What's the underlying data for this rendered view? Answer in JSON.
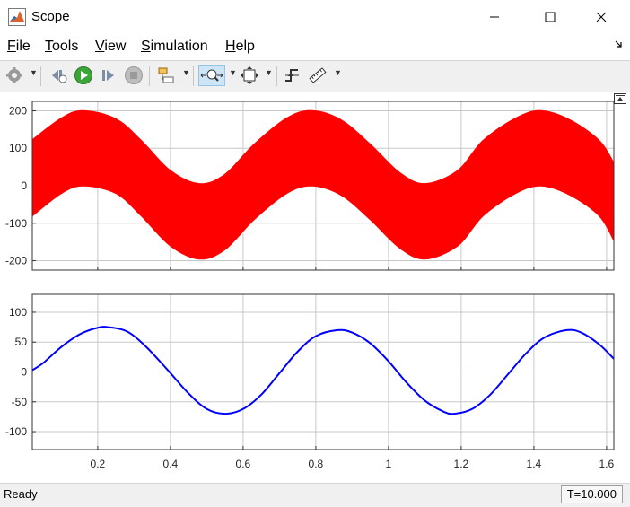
{
  "window": {
    "title": "Scope",
    "controls": [
      "minimize",
      "maximize",
      "close"
    ]
  },
  "menu": {
    "items": [
      {
        "label": "File",
        "mnemonic": "F",
        "rest": "ile"
      },
      {
        "label": "Tools",
        "mnemonic": "T",
        "rest": "ools"
      },
      {
        "label": "View",
        "mnemonic": "V",
        "rest": "iew"
      },
      {
        "label": "Simulation",
        "mnemonic": "S",
        "rest": "imulation"
      },
      {
        "label": "Help",
        "mnemonic": "H",
        "rest": "elp"
      }
    ]
  },
  "toolbar": {
    "buttons": [
      "settings-icon",
      "step-back-icon",
      "run-icon",
      "step-forward-icon",
      "stop-icon",
      "highlight-block-icon",
      "zoom-icon",
      "autoscale-icon",
      "triggers-icon",
      "measurements-icon"
    ],
    "active": "zoom-icon"
  },
  "status": {
    "text": "Ready",
    "time": "T=10.000"
  },
  "colors": {
    "top_signal": "#ff0000",
    "bottom_signal": "#0000ff",
    "grid": "#c8c8c8"
  },
  "chart_data": [
    {
      "type": "line",
      "title": "",
      "xlabel": "",
      "ylabel": "",
      "xlim": [
        0.02,
        1.62
      ],
      "ylim": [
        -225,
        225
      ],
      "grid": true,
      "x_ticks": [
        0.2,
        0.4,
        0.6,
        0.8,
        1,
        1.2,
        1.4,
        1.6
      ],
      "y_ticks": [
        200,
        100,
        0,
        -100,
        -200
      ],
      "series": [
        {
          "color": "#ff0000",
          "band": true,
          "x": [
            0.02,
            0.1,
            0.16,
            0.25,
            0.32,
            0.4,
            0.48,
            0.55,
            0.63,
            0.72,
            0.79,
            0.87,
            0.95,
            1.03,
            1.1,
            1.19,
            1.26,
            1.35,
            1.42,
            1.5,
            1.58,
            1.62
          ],
          "upper": [
            122,
            180,
            200,
            178,
            120,
            40,
            5,
            30,
            110,
            180,
            200,
            175,
            110,
            35,
            5,
            40,
            120,
            180,
            200,
            175,
            120,
            60
          ],
          "lower": [
            -80,
            -20,
            0,
            -20,
            -80,
            -160,
            -195,
            -170,
            -90,
            -20,
            0,
            -25,
            -90,
            -165,
            -195,
            -160,
            -80,
            -20,
            0,
            -25,
            -80,
            -145
          ]
        }
      ]
    },
    {
      "type": "line",
      "title": "",
      "xlabel": "",
      "ylabel": "",
      "xlim": [
        0.02,
        1.62
      ],
      "ylim": [
        -130,
        130
      ],
      "grid": true,
      "x_ticks": [
        0.2,
        0.4,
        0.6,
        0.8,
        1,
        1.2,
        1.4,
        1.6
      ],
      "x_tick_labels": [
        "0.2",
        "0.4",
        "0.6",
        "0.8",
        "1",
        "1.2",
        "1.4",
        "1.6"
      ],
      "y_ticks": [
        100,
        50,
        0,
        -50,
        -100
      ],
      "series": [
        {
          "color": "#0000ff",
          "x": [
            0.02,
            0.05,
            0.1,
            0.15,
            0.2,
            0.23,
            0.28,
            0.33,
            0.39,
            0.45,
            0.5,
            0.55,
            0.6,
            0.65,
            0.7,
            0.75,
            0.8,
            0.86,
            0.9,
            0.95,
            1.0,
            1.05,
            1.1,
            1.15,
            1.18,
            1.23,
            1.28,
            1.33,
            1.38,
            1.43,
            1.49,
            1.53,
            1.58,
            1.62
          ],
          "y": [
            3,
            15,
            42,
            63,
            74,
            75,
            68,
            44,
            5,
            -36,
            -62,
            -70,
            -62,
            -38,
            -2,
            34,
            60,
            70,
            66,
            48,
            18,
            -18,
            -48,
            -66,
            -70,
            -62,
            -38,
            -3,
            32,
            58,
            70,
            66,
            46,
            22
          ]
        }
      ]
    }
  ]
}
